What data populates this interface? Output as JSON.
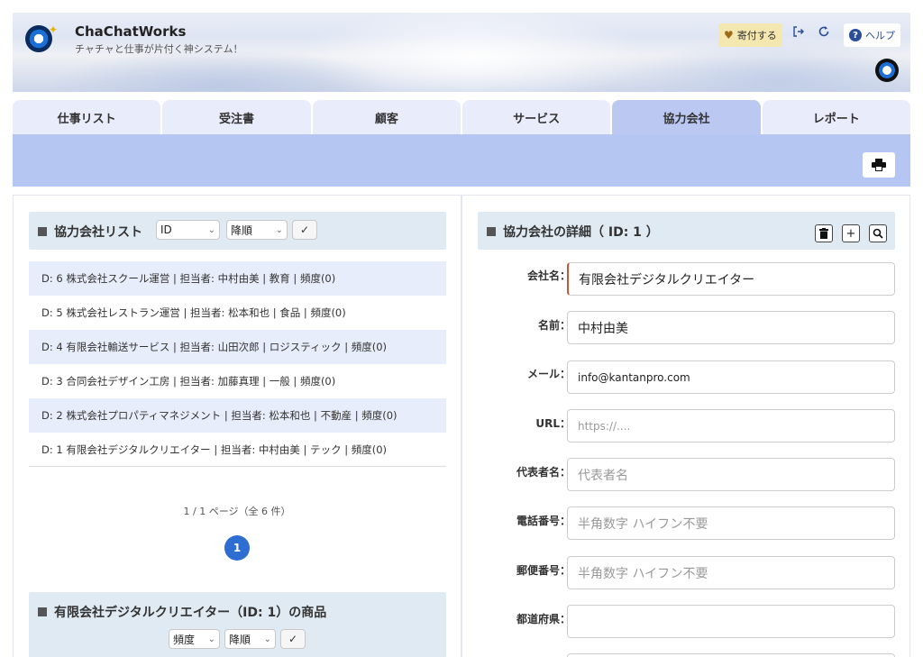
{
  "header": {
    "app_title": "ChaChatWorks",
    "app_subtitle": "チャチャと仕事が片付く神システム！",
    "donate_label": "寄付する",
    "help_label": "ヘルプ"
  },
  "tabs": [
    {
      "label": "仕事リスト"
    },
    {
      "label": "受注書"
    },
    {
      "label": "顧客"
    },
    {
      "label": "サービス"
    },
    {
      "label": "協力会社"
    },
    {
      "label": "レポート"
    }
  ],
  "list_section": {
    "title": "協力会社リスト",
    "sort_field": "ID",
    "sort_order": "降順",
    "rows": [
      {
        "text": "D: 6 株式会社スクール運営 | 担当者: 中村由美 | 教育 | 頻度(0)"
      },
      {
        "text": "D: 5 株式会社レストラン運営 | 担当者: 松本和也 | 食品 | 頻度(0)"
      },
      {
        "text": "D: 4 有限会社輸送サービス | 担当者: 山田次郎 | ロジスティック | 頻度(0)"
      },
      {
        "text": "D: 3 合同会社デザイン工房 | 担当者: 加藤真理 | 一般 | 頻度(0)"
      },
      {
        "text": "D: 2 株式会社プロパティマネジメント | 担当者: 松本和也 | 不動産 | 頻度(0)"
      },
      {
        "text": "D: 1 有限会社デジタルクリエイター | 担当者: 中村由美 | テック | 頻度(0)"
      }
    ],
    "page_info": "1 / 1 ページ（全 6 件）",
    "current_page": "1"
  },
  "products_section": {
    "title": "有限会社デジタルクリエイター（ID: 1）の商品",
    "sort_field": "頻度",
    "sort_order": "降順"
  },
  "detail": {
    "title": "協力会社の詳細（ ID: 1 ）",
    "fields": {
      "company": {
        "label": "会社名：",
        "value": "有限会社デジタルクリエイター"
      },
      "name": {
        "label": "名前：",
        "value": "中村由美"
      },
      "email": {
        "label": "メール：",
        "value": "info@kantanpro.com"
      },
      "url": {
        "label": "URL：",
        "placeholder": "https://...."
      },
      "rep": {
        "label": "代表者名：",
        "placeholder": "代表者名"
      },
      "phone": {
        "label": "電話番号：",
        "placeholder": "半角数字 ハイフン不要"
      },
      "zip": {
        "label": "郵便番号：",
        "placeholder": "半角数字 ハイフン不要"
      },
      "pref": {
        "label": "都道府県：",
        "value": ""
      }
    }
  },
  "icons": [
    "app-logo-icon",
    "heart-icon",
    "logout-icon",
    "refresh-icon",
    "help-icon",
    "user-avatar-icon",
    "print-icon",
    "trash-icon",
    "plus-icon",
    "search-icon",
    "check-icon",
    "chevron-down-icon"
  ]
}
